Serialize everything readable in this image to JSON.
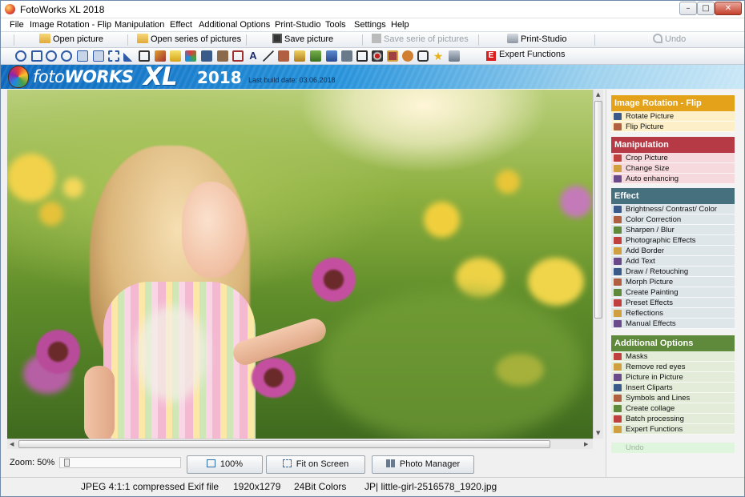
{
  "window": {
    "title": "FotoWorks XL 2018",
    "controls": {
      "minimize": "–",
      "maximize": "□",
      "close": "✕"
    }
  },
  "menu": [
    "File",
    "Image Rotation - Flip",
    "Manipulation",
    "Effect",
    "Additional Options",
    "Print-Studio",
    "Tools",
    "Settings",
    "Help"
  ],
  "toolbar": {
    "open_picture": "Open picture",
    "open_series": "Open series of pictures",
    "save_picture": "Save picture",
    "save_serie": "Save serie of pictures",
    "print_studio": "Print-Studio",
    "undo": "Undo",
    "expert": "Expert Functions",
    "expert_badge": "E"
  },
  "banner": {
    "logo_foto": "foto",
    "logo_works": "WORKS",
    "logo_xl": "XL",
    "logo_year": "2018",
    "build": "Last build date: 03.06.2018"
  },
  "zoom": {
    "label": "Zoom: 50%",
    "value_percent": 50
  },
  "buttons": {
    "zoom100": "100%",
    "fit": "Fit on Screen",
    "photo_manager": "Photo Manager"
  },
  "status": {
    "format": "JPEG 4:1:1 compressed Exif file",
    "size": "1920x1279",
    "colors": "24Bit Colors",
    "file": "JP| little-girl-2516578_1920.jpg"
  },
  "panel": {
    "sections": [
      {
        "title": "Image Rotation - Flip",
        "color": "#e3a21a",
        "bg": "#fdf0c9",
        "items": [
          "Rotate Picture",
          "Flip Picture"
        ]
      },
      {
        "title": "Manipulation",
        "color": "#b53a45",
        "bg": "#f5d9dc",
        "items": [
          "Crop Picture",
          "Change Size",
          "Auto enhancing"
        ]
      },
      {
        "title": "Effect",
        "color": "#47707f",
        "bg": "#dfe6ea",
        "items": [
          "Brightness/ Contrast/ Color",
          "Color Correction",
          "Sharpen / Blur",
          "Photographic Effects",
          "Add Border",
          "Add Text",
          "Draw / Retouching",
          "Morph Picture",
          "Create Painting",
          "Preset Effects",
          "Reflections",
          "Manual Effects"
        ]
      },
      {
        "title": "Additional Options",
        "color": "#5f8a3c",
        "bg": "#e3ecd8",
        "items": [
          "Masks",
          "Remove red eyes",
          "Picture in Picture",
          "Insert Cliparts",
          "Symbols and Lines",
          "Create collage",
          "Batch processing",
          "Expert Functions"
        ]
      }
    ],
    "undo": "Undo"
  }
}
